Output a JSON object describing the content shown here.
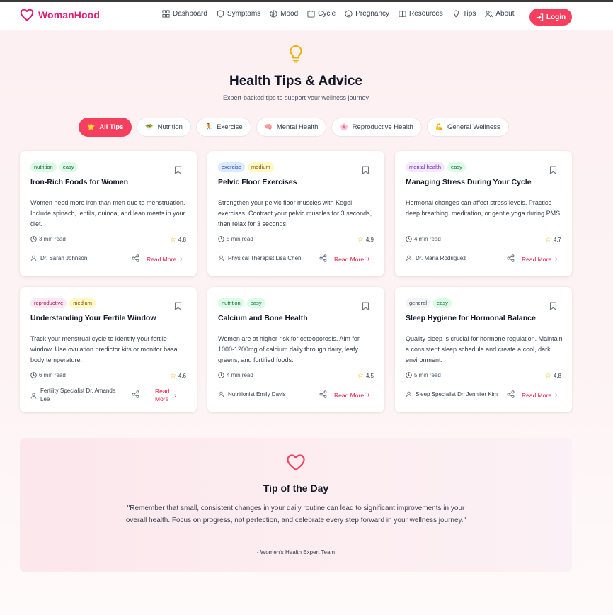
{
  "brand": {
    "name": "WomanHood",
    "color": "#e11d74"
  },
  "nav": {
    "items": [
      {
        "label": "Dashboard",
        "icon": "dashboard-icon"
      },
      {
        "label": "Symptoms",
        "icon": "shield-icon"
      },
      {
        "label": "Mood",
        "icon": "mood-icon"
      },
      {
        "label": "Cycle",
        "icon": "calendar-icon"
      },
      {
        "label": "Pregnancy",
        "icon": "baby-icon"
      },
      {
        "label": "Resources",
        "icon": "book-icon"
      },
      {
        "label": "Tips",
        "icon": "lightbulb-icon"
      },
      {
        "label": "About",
        "icon": "users-icon"
      }
    ],
    "login_label": "Login"
  },
  "page": {
    "title": "Health Tips & Advice",
    "subtitle": "Expert-backed tips to support your wellness journey"
  },
  "filters": [
    {
      "label": "All Tips",
      "emoji": "🌟",
      "active": true
    },
    {
      "label": "Nutrition",
      "emoji": "🥗",
      "active": false
    },
    {
      "label": "Exercise",
      "emoji": "🏃",
      "active": false
    },
    {
      "label": "Mental Health",
      "emoji": "🧠",
      "active": false
    },
    {
      "label": "Reproductive Health",
      "emoji": "🌸",
      "active": false
    },
    {
      "label": "General Wellness",
      "emoji": "💪",
      "active": false
    }
  ],
  "cards": [
    {
      "tags": [
        "nutrition",
        "easy"
      ],
      "title": "Iron-Rich Foods for Women",
      "body": "Women need more iron than men due to menstruation. Include spinach, lentils, quinoa, and lean meats in your diet.",
      "read_time": "3 min read",
      "rating": "4.8",
      "author": "Dr. Sarah Johnson",
      "read_more": "Read More"
    },
    {
      "tags": [
        "exercise",
        "medium"
      ],
      "title": "Pelvic Floor Exercises",
      "body": "Strengthen your pelvic floor muscles with Kegel exercises. Contract your pelvic muscles for 3 seconds, then relax for 3 seconds.",
      "read_time": "5 min read",
      "rating": "4.9",
      "author": "Physical Therapist Lisa Chen",
      "read_more": "Read More"
    },
    {
      "tags": [
        "mental health",
        "easy"
      ],
      "title": "Managing Stress During Your Cycle",
      "body": "Hormonal changes can affect stress levels. Practice deep breathing, meditation, or gentle yoga during PMS.",
      "read_time": "4 min read",
      "rating": "4.7",
      "author": "Dr. Maria Rodriguez",
      "read_more": "Read More"
    },
    {
      "tags": [
        "reproductive",
        "medium"
      ],
      "title": "Understanding Your Fertile Window",
      "body": "Track your menstrual cycle to identify your fertile window. Use ovulation predictor kits or monitor basal body temperature.",
      "read_time": "6 min read",
      "rating": "4.6",
      "author": "Fertility Specialist Dr. Amanda Lee",
      "read_more": "Read More"
    },
    {
      "tags": [
        "nutrition",
        "easy"
      ],
      "title": "Calcium and Bone Health",
      "body": "Women are at higher risk for osteoporosis. Aim for 1000-1200mg of calcium daily through dairy, leafy greens, and fortified foods.",
      "read_time": "4 min read",
      "rating": "4.5",
      "author": "Nutritionist Emily Davis",
      "read_more": "Read More"
    },
    {
      "tags": [
        "general",
        "easy"
      ],
      "title": "Sleep Hygiene for Hormonal Balance",
      "body": "Quality sleep is crucial for hormone regulation. Maintain a consistent sleep schedule and create a cool, dark environment.",
      "read_time": "5 min read",
      "rating": "4.8",
      "author": "Sleep Specialist Dr. Jennifer Kim",
      "read_more": "Read More"
    }
  ],
  "tag_colors": {
    "nutrition": {
      "bg": "#dcfce7",
      "fg": "#166534"
    },
    "easy": {
      "bg": "#dcfce7",
      "fg": "#166534"
    },
    "exercise": {
      "bg": "#dbeafe",
      "fg": "#1e40af"
    },
    "medium": {
      "bg": "#fef9c3",
      "fg": "#854d0e"
    },
    "mental health": {
      "bg": "#f3e8ff",
      "fg": "#6b21a8"
    },
    "reproductive": {
      "bg": "#fce7f3",
      "fg": "#9d174d"
    },
    "general": {
      "bg": "#f3f4f6",
      "fg": "#374151"
    }
  },
  "tip_of_day": {
    "title": "Tip of the Day",
    "quote": "\"Remember that small, consistent changes in your daily routine can lead to significant improvements in your overall health. Focus on progress, not perfection, and celebrate every step forward in your wellness journey.\"",
    "author": "- Women's Health Expert Team"
  },
  "colors": {
    "accent": "#f43f5e",
    "link": "#e11d48",
    "star": "#eab308"
  }
}
